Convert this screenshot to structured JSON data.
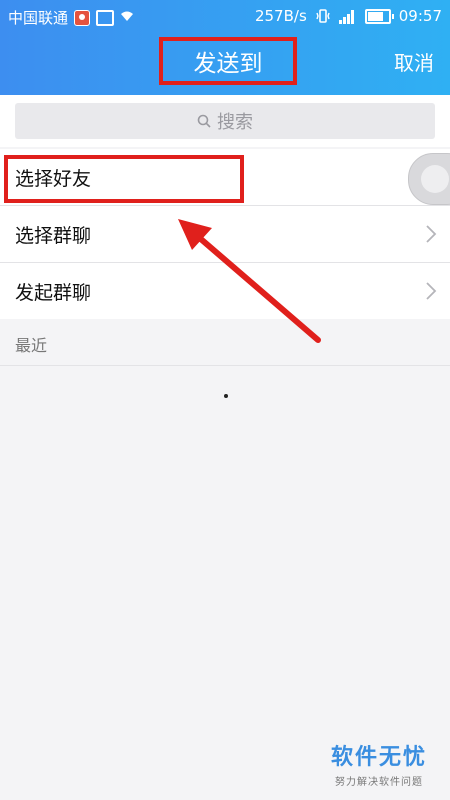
{
  "status_bar": {
    "carrier": "中国联通",
    "speed": "257B/s",
    "time": "09:57",
    "icons": [
      "location-icon",
      "image-icon",
      "wifi-icon",
      "vibrate-icon",
      "signal-icon",
      "battery-icon"
    ]
  },
  "header": {
    "title": "发送到",
    "cancel_label": "取消",
    "gradient_start": "#3d8ef0",
    "gradient_end": "#2fb0f3"
  },
  "search": {
    "placeholder": "搜索"
  },
  "menu": {
    "items": [
      {
        "label": "选择好友"
      },
      {
        "label": "选择群聊"
      },
      {
        "label": "发起群聊"
      }
    ]
  },
  "recent": {
    "header": "最近"
  },
  "annotation": {
    "highlight_color": "#e0201c"
  },
  "watermark": {
    "main": "软件无忧",
    "sub": "努力解决软件问题"
  }
}
